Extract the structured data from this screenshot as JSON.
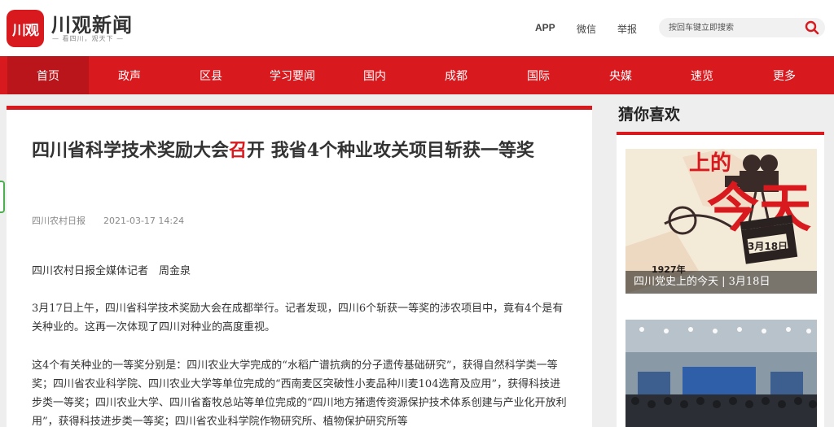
{
  "brand": {
    "badge": "川观",
    "name": "川观新闻",
    "slogan": "— 看四川，观天下 —"
  },
  "top_links": [
    "APP",
    "微信",
    "举报"
  ],
  "search": {
    "placeholder": "按回车键立即搜索"
  },
  "nav": [
    "首页",
    "政声",
    "区县",
    "学习要闻",
    "国内",
    "成都",
    "国际",
    "央媒",
    "速览",
    "更多"
  ],
  "article": {
    "title_part1": "四川省科学技术奖励大会",
    "title_part2": "召",
    "title_part3": "开 我省4个种业攻关项目斩获一等奖",
    "source": "四川农村日报",
    "datetime": "2021-03-17 14:24",
    "paragraphs": [
      "四川农村日报全媒体记者　周金泉",
      "3月17日上午，四川省科学技术奖励大会在成都举行。记者发现，四川6个斩获一等奖的涉农项目中，竟有4个是有关种业的。这再一次体现了四川对种业的高度重视。",
      "这4个有关种业的一等奖分别是：四川农业大学完成的“水稻广谱抗病的分子遗传基础研究”，获得自然科学类一等奖；四川省农业科学院、四川农业大学等单位完成的“西南麦区突破性小麦品种川麦104选育及应用”，获得科技进步类一等奖；四川农业大学、四川省畜牧总站等单位完成的“四川地方猪遗传资源保护技术体系创建与产业化开放利用”，获得科技进步类一等奖；四川省农业科学院作物研究所、植物保护研究所等"
    ]
  },
  "sidebar": {
    "title": "猜你喜欢",
    "cards": [
      {
        "caption": "四川党史上的今天 | 3月18日",
        "art_big": "今天",
        "art_small": "上的",
        "date_tag": "3月18日",
        "year": "1927年"
      },
      {
        "caption": ""
      }
    ]
  },
  "colors": {
    "accent": "#d8191e",
    "nav_active": "#b9151a"
  }
}
